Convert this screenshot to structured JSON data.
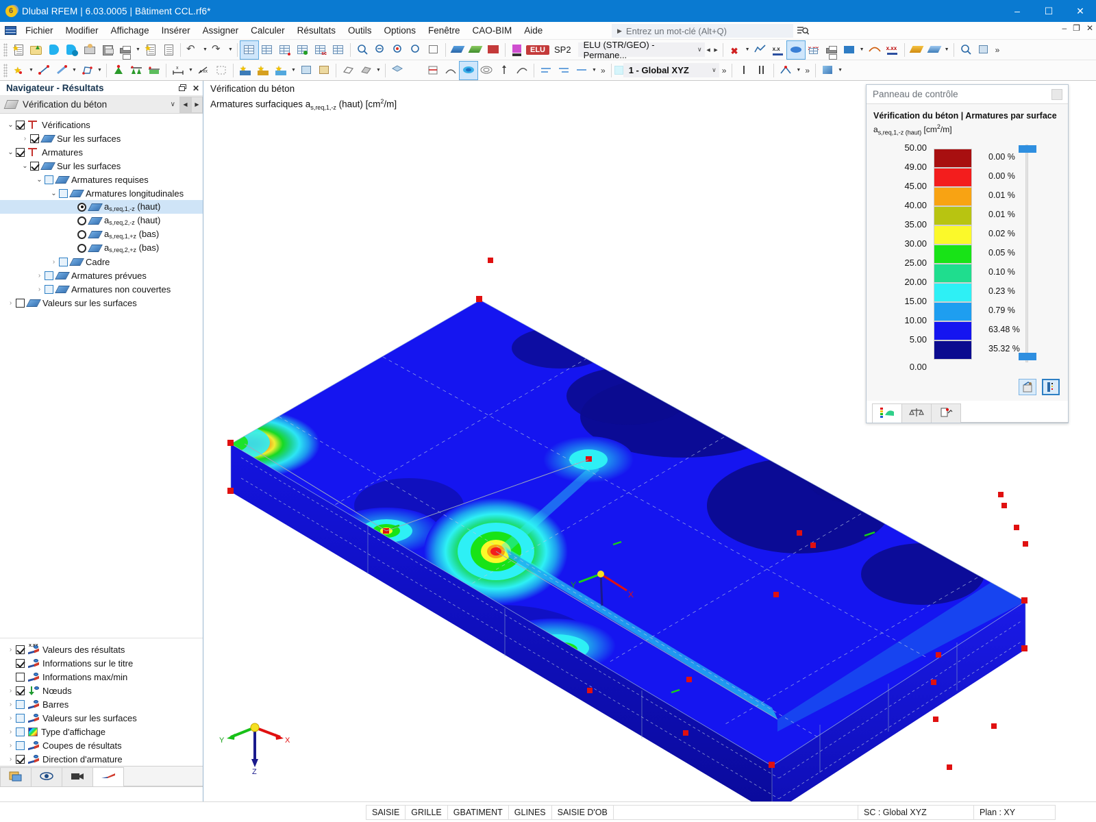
{
  "window": {
    "title": "Dlubal RFEM | 6.03.0005 | Bâtiment CCL.rf6*",
    "app_icon": "dlubal-logo",
    "minimize": "–",
    "maximize": "☐",
    "close": "✕",
    "mdi_minimize": "–",
    "mdi_restore": "❐",
    "mdi_close": "✕"
  },
  "menu": {
    "items": [
      {
        "label": "Fichier"
      },
      {
        "label": "Modifier"
      },
      {
        "label": "Affichage"
      },
      {
        "label": "Insérer"
      },
      {
        "label": "Assigner"
      },
      {
        "label": "Calculer"
      },
      {
        "label": "Résultats"
      },
      {
        "label": "Outils"
      },
      {
        "label": "Options"
      },
      {
        "label": "Fenêtre"
      },
      {
        "label": "CAO-BIM"
      },
      {
        "label": "Aide"
      }
    ],
    "keyword_search": {
      "placeholder": "Entrez un mot-clé (Alt+Q)",
      "caret": "▶",
      "icon": "search-list-icon"
    }
  },
  "toolbar": {
    "load_case": {
      "badge": "ELU",
      "code": "SP2",
      "selected": "ELU (STR/GEO) - Permane...",
      "chevron": "∨",
      "prev": "◀",
      "next": "▶"
    },
    "coordinate_system": {
      "selected": "1 - Global XYZ",
      "chevron": "∨",
      "overflow": "»"
    },
    "overflow": "»",
    "row1_icons": [
      "new-file-icon",
      "open-folder-icon",
      "rfem-blue-icon",
      "rfem-settings-icon",
      "import-icon",
      "save-icon",
      "print-icon",
      "new-report-icon",
      "report-icon",
      "undo-icon",
      "redo-icon",
      "table-icon",
      "table2-icon",
      "table3-icon",
      "table4-icon",
      "table5-icon",
      "table6-icon",
      "render-icon",
      "zoom-icon",
      "zoom2-icon",
      "zoom3-icon",
      "zoom4-icon",
      "surface-results-icon",
      "surface-results2-icon"
    ],
    "row2_icons": [
      "node-icon",
      "line-icon",
      "member-icon",
      "surface-icon",
      "support-icon",
      "line-support-icon",
      "surface-support-icon",
      "dimension-icon",
      "dimension2-icon",
      "grid-icon",
      "load-icon",
      "load2-icon",
      "load3-icon",
      "load4-icon",
      "load5-icon",
      "render-solid-icon",
      "render-wire-icon",
      "section-icon",
      "isoline-icon",
      "isoband-icon",
      "deform-icon"
    ]
  },
  "navigator": {
    "title": "Navigateur - Résultats",
    "restore_icon": "restore-icon",
    "close_icon": "close-icon",
    "module_combo": {
      "label": "Vérification du béton",
      "icon": "concrete-icon",
      "chevron": "∨",
      "prev": "◀",
      "next": "▶"
    },
    "tree": [
      {
        "id": "verifications",
        "indent": 0,
        "twist": "open",
        "check": "checked",
        "icon": "check-icon",
        "label": "Vérifications"
      },
      {
        "id": "ver-surfaces",
        "indent": 1,
        "twist": "closed",
        "check": "checked",
        "icon": "surface-icon",
        "label": "Sur les surfaces"
      },
      {
        "id": "armatures",
        "indent": 0,
        "twist": "open",
        "check": "checked",
        "icon": "check-icon",
        "label": "Armatures"
      },
      {
        "id": "arm-surfaces",
        "indent": 1,
        "twist": "open",
        "check": "checked",
        "icon": "surface-icon",
        "label": "Sur les surfaces"
      },
      {
        "id": "arm-requises",
        "indent": 2,
        "twist": "open",
        "check": "blue",
        "icon": "surface-icon",
        "label": "Armatures requises"
      },
      {
        "id": "arm-longi",
        "indent": 3,
        "twist": "open",
        "check": "blue",
        "icon": "surface-icon",
        "label": "Armatures longitudinales"
      },
      {
        "id": "as-1-mz",
        "indent": 4,
        "radio": "on",
        "icon": "surface-icon",
        "label": "a",
        "subscript": "s,req,1,-z",
        "suffix": " (haut)",
        "selected": true
      },
      {
        "id": "as-2-mz",
        "indent": 4,
        "radio": "off",
        "icon": "surface-icon",
        "label": "a",
        "subscript": "s,req,2,-z",
        "suffix": " (haut)"
      },
      {
        "id": "as-1-pz",
        "indent": 4,
        "radio": "off",
        "icon": "surface-icon",
        "label": "a",
        "subscript": "s,req,1,+z",
        "suffix": " (bas)"
      },
      {
        "id": "as-2-pz",
        "indent": 4,
        "radio": "off",
        "icon": "surface-icon",
        "label": "a",
        "subscript": "s,req,2,+z",
        "suffix": " (bas)"
      },
      {
        "id": "cadre",
        "indent": 3,
        "twist": "closed",
        "check": "blue",
        "icon": "surface-icon",
        "label": "Cadre"
      },
      {
        "id": "arm-prevues",
        "indent": 2,
        "twist": "closed",
        "check": "blue",
        "icon": "surface-icon",
        "label": "Armatures prévues"
      },
      {
        "id": "arm-non-couvertes",
        "indent": 2,
        "twist": "closed",
        "check": "blue",
        "icon": "surface-icon",
        "label": "Armatures non couvertes"
      },
      {
        "id": "valeurs-surfaces",
        "indent": 1,
        "twist": "closed",
        "check": "empty",
        "icon": "surface-icon",
        "label": "Valeurs sur les surfaces"
      }
    ],
    "display_tree": [
      {
        "id": "valeurs-resultats",
        "twist": "closed",
        "check": "checked",
        "icon": "results-values-icon",
        "label": "Valeurs des résultats"
      },
      {
        "id": "infos-titre",
        "twist": "none",
        "check": "checked",
        "icon": "results-icon",
        "label": "Informations sur le titre"
      },
      {
        "id": "infos-maxmin",
        "twist": "none",
        "check": "empty",
        "icon": "results-icon",
        "label": "Informations max/min"
      },
      {
        "id": "noeuds",
        "twist": "closed",
        "check": "checked",
        "icon": "node-icon",
        "label": "Nœuds"
      },
      {
        "id": "barres",
        "twist": "closed",
        "check": "blue",
        "icon": "results-icon",
        "label": "Barres"
      },
      {
        "id": "valeurs-sur-surfaces",
        "twist": "closed",
        "check": "blue",
        "icon": "results-icon",
        "label": "Valeurs sur les surfaces"
      },
      {
        "id": "type-affichage",
        "twist": "closed",
        "check": "blue",
        "icon": "rainbow-icon",
        "label": "Type d'affichage"
      },
      {
        "id": "coupes-resultats",
        "twist": "closed",
        "check": "blue",
        "icon": "results-icon",
        "label": "Coupes de résultats"
      },
      {
        "id": "direction-armature",
        "twist": "closed",
        "check": "checked",
        "icon": "results-icon",
        "label": "Direction d'armature"
      }
    ],
    "tabs": [
      {
        "id": "tab-data",
        "icon": "data-navigator-icon",
        "active": false
      },
      {
        "id": "tab-display",
        "icon": "eye-icon",
        "active": false
      },
      {
        "id": "tab-views",
        "icon": "camera-icon",
        "active": false
      },
      {
        "id": "tab-results",
        "icon": "results-icon",
        "active": true
      }
    ]
  },
  "viewport": {
    "title_line1": "Vérification du béton",
    "title_line2_prefix": "Armatures surfaciques a",
    "title_line2_sub": "s,req,1,-z",
    "title_line2_suffix": " (haut) [cm",
    "title_line2_exp": "2",
    "title_line2_end": "/m]",
    "axes": {
      "x": "X",
      "y": "Y",
      "z": "Z"
    }
  },
  "control_panel": {
    "title": "Panneau de contrôle",
    "pin_icon": "pin-icon",
    "heading": "Vérification du béton | Armatures par surface",
    "subheading_prefix": "a",
    "subheading_sub": "s,req,1,-z (haut)",
    "subheading_unit_prefix": " [cm",
    "subheading_unit_exp": "2",
    "subheading_unit_end": "/m]",
    "legend": {
      "values": [
        "50.00",
        "49.00",
        "45.00",
        "40.00",
        "35.00",
        "30.00",
        "25.00",
        "20.00",
        "15.00",
        "10.00",
        "5.00",
        "0.00"
      ],
      "bands": [
        {
          "color": "#a80f10",
          "percent": "0.00 %"
        },
        {
          "color": "#f31d1d",
          "percent": "0.00 %"
        },
        {
          "color": "#f8a313",
          "percent": "0.01 %"
        },
        {
          "color": "#b8c411",
          "percent": "0.01 %"
        },
        {
          "color": "#fbf92a",
          "percent": "0.02 %"
        },
        {
          "color": "#18e317",
          "percent": "0.05 %"
        },
        {
          "color": "#1fdd8e",
          "percent": "0.10 %"
        },
        {
          "color": "#2ef0f5",
          "percent": "0.23 %"
        },
        {
          "color": "#1e9ef0",
          "percent": "0.79 %"
        },
        {
          "color": "#1515f0",
          "percent": "63.48 %"
        },
        {
          "color": "#0b0b8f",
          "percent": "35.32 %"
        }
      ],
      "slider_top_knob": "#2f8fe0",
      "slider_bottom_knob": "#2f8fe0"
    },
    "tool_buttons": [
      {
        "id": "cp-btn-colors",
        "icon": "color-palette-icon",
        "selected": false
      },
      {
        "id": "cp-btn-scale",
        "icon": "scale-edit-icon",
        "selected": true
      }
    ],
    "tabs": [
      {
        "id": "cp-tab-legend",
        "icon": "color-legend-icon",
        "active": true
      },
      {
        "id": "cp-tab-factors",
        "icon": "scales-icon",
        "active": false
      },
      {
        "id": "cp-tab-filter",
        "icon": "filter-icon",
        "active": false
      }
    ]
  },
  "statusbar": {
    "left_cells": [
      "SAISIE",
      "GRILLE",
      "GBATIMENT",
      "GLINES",
      "SAISIE D'OB"
    ],
    "right_cells": [
      "SC : Global XYZ",
      "Plan : XY"
    ]
  },
  "chart_data": {
    "type": "heatmap",
    "title": "Armatures surfaciques a_s,req,1,-z (haut)",
    "unit": "cm2/m",
    "legend_levels": [
      50.0,
      49.0,
      45.0,
      40.0,
      35.0,
      30.0,
      25.0,
      20.0,
      15.0,
      10.0,
      5.0,
      0.0
    ],
    "band_percentages": [
      0.0,
      0.0,
      0.01,
      0.01,
      0.02,
      0.05,
      0.1,
      0.23,
      0.79,
      63.48,
      35.32
    ],
    "band_colors": [
      "#a80f10",
      "#f31d1d",
      "#f8a313",
      "#b8c411",
      "#fbf92a",
      "#18e317",
      "#1fdd8e",
      "#2ef0f5",
      "#1e9ef0",
      "#1515f0",
      "#0b0b8f"
    ]
  }
}
